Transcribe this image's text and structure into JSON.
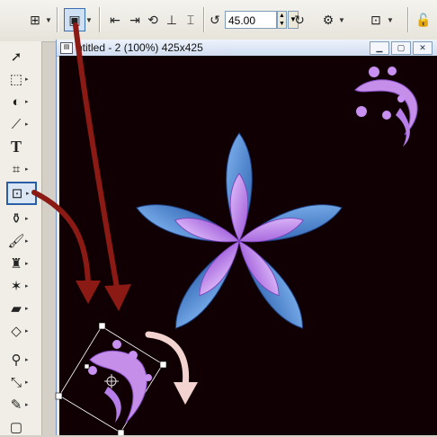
{
  "toolbar": {
    "angle_value": "45.00",
    "icons": [
      "grid-icon",
      "deform-mode-icon",
      "flip-icon",
      "mirror-icon",
      "rotate-icon",
      "align-icon",
      "distribute-icon",
      "rotate-left-icon",
      "rotate-right-icon",
      "settings-icon",
      "center-icon",
      "lock-icon"
    ]
  },
  "tools": [
    "pick-tool",
    "selection-tool",
    "freehand-tool",
    "straighten-tool",
    "text-tool",
    "crop-tool",
    "deform-tool",
    "dropper-tool",
    "brush-tool",
    "clone-tool",
    "retouch-tool",
    "eraser-tool",
    "fill-tool",
    "zoom-tool",
    "color-picker-tool",
    "pen-tool",
    "object-tool"
  ],
  "document": {
    "title": "ntitled - 2 (100%) 425x425"
  },
  "colors": {
    "canvas": "#110003",
    "arrow": "#8b1a14",
    "curved_arrow": "#f2d3cf",
    "petal_outer": "#4a8ad9",
    "petal_inner": "#b77de8",
    "selection_handle": "#ffffff"
  }
}
